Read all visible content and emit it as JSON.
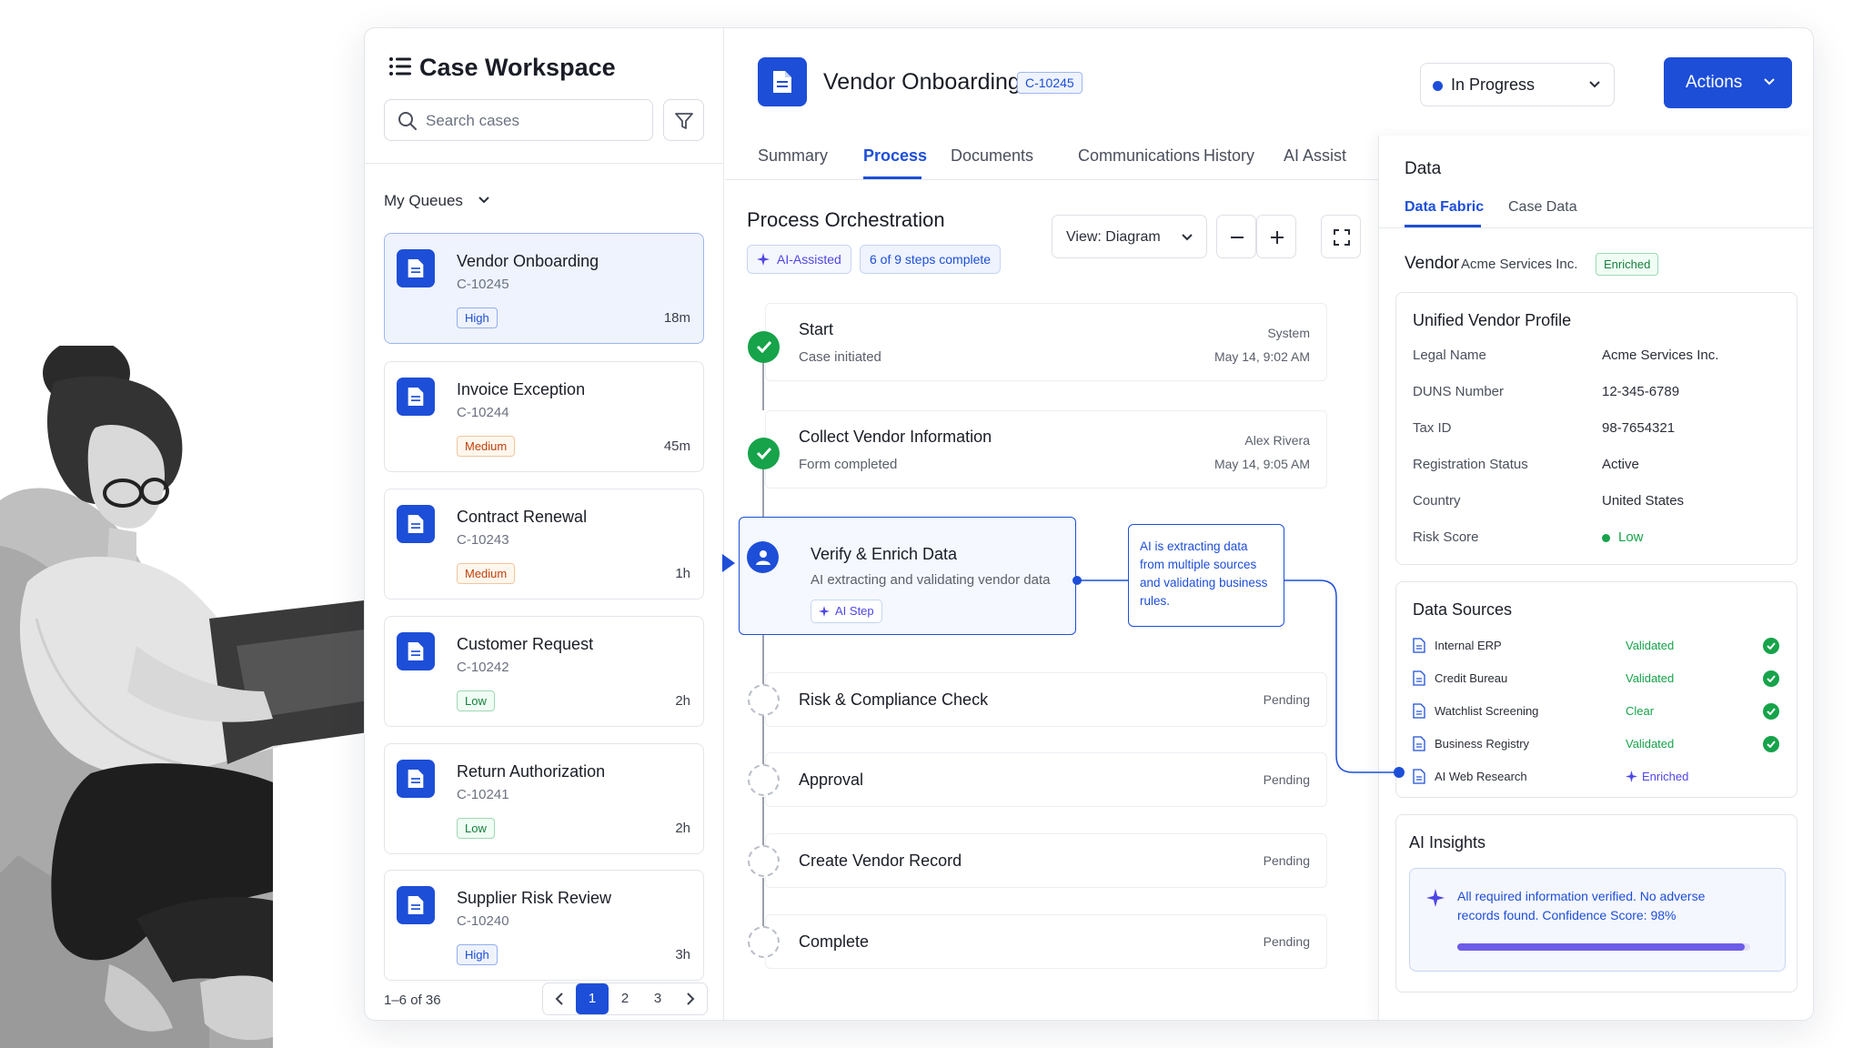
{
  "sidebar": {
    "title": "Case Workspace",
    "search_placeholder": "Search cases",
    "queues_label": "My Queues",
    "cases": [
      {
        "title": "Vendor Onboarding",
        "id": "C-10245",
        "priority": "High",
        "age": "18m",
        "active": true
      },
      {
        "title": "Invoice Exception",
        "id": "C-10244",
        "priority": "Medium",
        "age": "45m"
      },
      {
        "title": "Contract Renewal",
        "id": "C-10243",
        "priority": "Medium",
        "age": "1h"
      },
      {
        "title": "Customer Request",
        "id": "C-10242",
        "priority": "Low",
        "age": "2h"
      },
      {
        "title": "Return Authorization",
        "id": "C-10241",
        "priority": "Low",
        "age": "2h"
      },
      {
        "title": "Supplier Risk Review",
        "id": "C-10240",
        "priority": "High",
        "age": "3h"
      }
    ],
    "pagination": {
      "info": "1–6 of 36",
      "pages": [
        "1",
        "2",
        "3"
      ],
      "current": "1",
      "prev_icon": "chevron-left-icon",
      "next_icon": "chevron-right-icon"
    }
  },
  "header": {
    "title": "Vendor Onboarding",
    "case_id": "C-10245",
    "status": "In Progress",
    "actions_label": "Actions"
  },
  "tabs": [
    "Summary",
    "Process",
    "Documents",
    "Communications",
    "History",
    "AI Assist"
  ],
  "active_tab": "Process",
  "process": {
    "title": "Process Orchestration",
    "ai_chip": "AI-Assisted",
    "steps_chip": "6 of 9 steps complete",
    "view_select": "View: Diagram",
    "steps": [
      {
        "name": "Start",
        "sub": "Case initiated",
        "actor": "System",
        "time": "May 14, 9:02 AM",
        "state": "done"
      },
      {
        "name": "Collect Vendor Information",
        "sub": "Form completed",
        "actor": "Alex Rivera",
        "time": "May 14, 9:05 AM",
        "state": "done"
      },
      {
        "name": "Verify & Enrich Data",
        "sub": "AI extracting and validating vendor data",
        "tag": "AI Step",
        "state": "current"
      },
      {
        "name": "Risk & Compliance Check",
        "status": "Pending",
        "state": "pending"
      },
      {
        "name": "Approval",
        "status": "Pending",
        "state": "pending"
      },
      {
        "name": "Create Vendor Record",
        "status": "Pending",
        "state": "pending"
      },
      {
        "name": "Complete",
        "status": "Pending",
        "state": "pending"
      }
    ],
    "callout": "AI is extracting data from multiple sources and validating business rules."
  },
  "data_panel": {
    "title": "Data",
    "tabs": [
      "Data Fabric",
      "Case Data"
    ],
    "vendor_label": "Vendor",
    "vendor_name": "Acme Services Inc.",
    "vendor_badge": "Enriched",
    "profile": {
      "title": "Unified Vendor Profile",
      "fields": [
        {
          "k": "Legal Name",
          "v": "Acme Services Inc."
        },
        {
          "k": "DUNS Number",
          "v": "12-345-6789"
        },
        {
          "k": "Tax ID",
          "v": "98-7654321"
        },
        {
          "k": "Registration Status",
          "v": "Active"
        },
        {
          "k": "Country",
          "v": "United States"
        },
        {
          "k": "Risk Score",
          "v": "Low"
        }
      ]
    },
    "sources": {
      "title": "Data Sources",
      "items": [
        {
          "name": "Internal ERP",
          "status": "Validated"
        },
        {
          "name": "Credit Bureau",
          "status": "Validated"
        },
        {
          "name": "Watchlist Screening",
          "status": "Clear"
        },
        {
          "name": "Business Registry",
          "status": "Validated"
        },
        {
          "name": "AI Web Research",
          "status": "Enriched"
        }
      ]
    },
    "insights": {
      "title": "AI Insights",
      "text": "All required information verified. No adverse records found. Confidence Score: 98%",
      "confidence": 0.98
    }
  },
  "colors": {
    "accent": "#1d4ed8",
    "success": "#16a34a",
    "ai": "#4f46e5",
    "warning": "#c2410c"
  }
}
